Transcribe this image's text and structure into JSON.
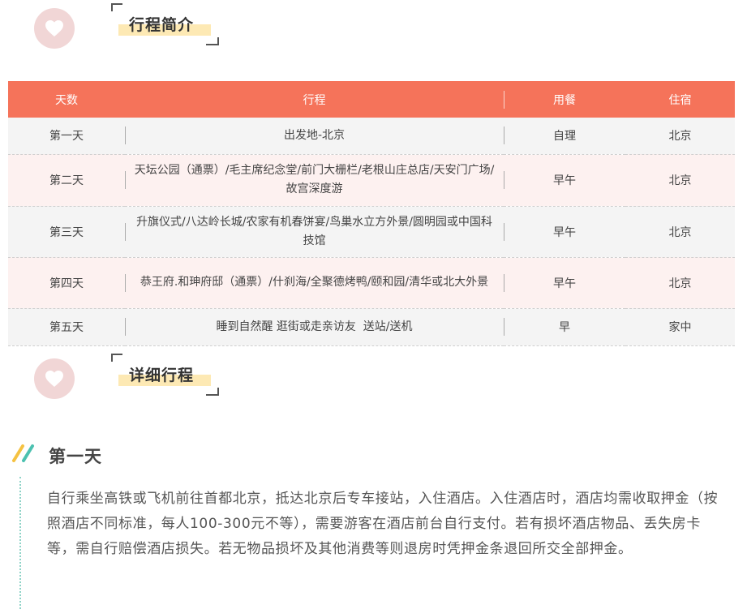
{
  "overview": {
    "title": "行程简介"
  },
  "table": {
    "headers": [
      "天数",
      "行程",
      "用餐",
      "住宿"
    ],
    "rows": [
      {
        "day": "第一天",
        "route": "出发地-北京",
        "meals": "自理",
        "stay": "北京"
      },
      {
        "day": "第二天",
        "route": "天坛公园（通票）/毛主席纪念堂/前门大栅栏/老根山庄总店/天安门广场/故宫深度游",
        "meals": "早午",
        "stay": "北京"
      },
      {
        "day": "第三天",
        "route": "升旗仪式/八达岭长城/农家有机春饼宴/鸟巢水立方外景/圆明园或中国科技馆",
        "meals": "早午",
        "stay": "北京"
      },
      {
        "day": "第四天",
        "route": "恭王府.和珅府邸（通票）/什刹海/全聚德烤鸭/颐和园/清华或北大外景",
        "meals": "早午",
        "stay": "北京"
      },
      {
        "day": "第五天",
        "route": "睡到自然醒 逛街或走亲访友  送站/送机",
        "meals": "早",
        "stay": "家中"
      }
    ]
  },
  "detail": {
    "title": "详细行程",
    "day1": {
      "title": "第一天",
      "text": "自行乘坐高铁或飞机前往首都北京，抵达北京后专车接站，入住酒店。入住酒店时，酒店均需收取押金（按照酒店不同标准，每人100-300元不等），需要游客在酒店前台自行支付。若有损坏酒店物品、丢失房卡等，需自行赔偿酒店损失。若无物品损坏及其他消费等则退房时凭押金条退回所交全部押金。"
    }
  },
  "colors": {
    "table_header": "#f5735a",
    "heart_circle": "#f1d6d6",
    "title_highlight": "#fde9b4",
    "accent_yellow": "#f5c242",
    "accent_teal": "#4cc1b0"
  }
}
